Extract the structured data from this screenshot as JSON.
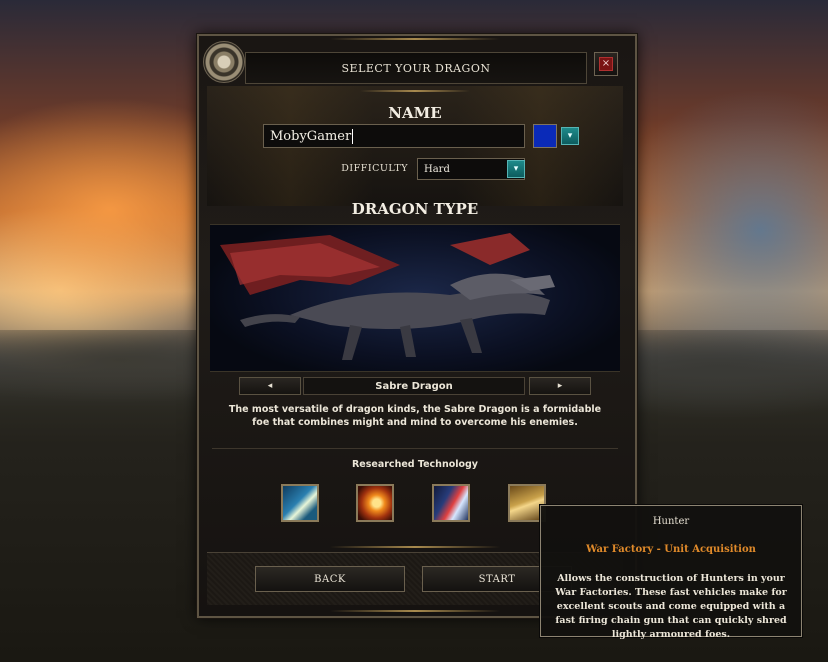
{
  "dialog": {
    "title": "SELECT YOUR DRAGON",
    "close_icon": "close-icon",
    "gear_icon": "gear-emblem-icon"
  },
  "name_section": {
    "heading": "NAME",
    "name_value": "MobyGamer",
    "color_value": "#0a2ab8",
    "dropdown_arrow": "▾"
  },
  "difficulty": {
    "label": "DIFFICULTY",
    "value": "Hard",
    "dropdown_arrow": "▾"
  },
  "dragon_type": {
    "heading": "DRAGON TYPE",
    "prev_arrow": "◂",
    "next_arrow": "▸",
    "name": "Sabre Dragon",
    "description": "The most versatile of dragon kinds, the Sabre Dragon is a formidable foe that combines might and mind to overcome his enemies."
  },
  "technology": {
    "heading": "Researched Technology",
    "icons": [
      "speed-arrow-icon",
      "fire-blade-icon",
      "lightning-strike-icon",
      "hunter-icon"
    ]
  },
  "buttons": {
    "back": "BACK",
    "start": "START"
  },
  "tooltip": {
    "title": "Hunter",
    "subtitle": "War Factory - Unit Acquisition",
    "body": "Allows the construction of Hunters in your War Factories. These fast vehicles make for excellent scouts and come equipped with a fast firing chain gun that can quickly shred lightly armoured foes."
  },
  "colors": {
    "accent_teal": "#1e8a8a",
    "tooltip_subtitle": "#e08a2a",
    "close_red": "#7a1414"
  }
}
